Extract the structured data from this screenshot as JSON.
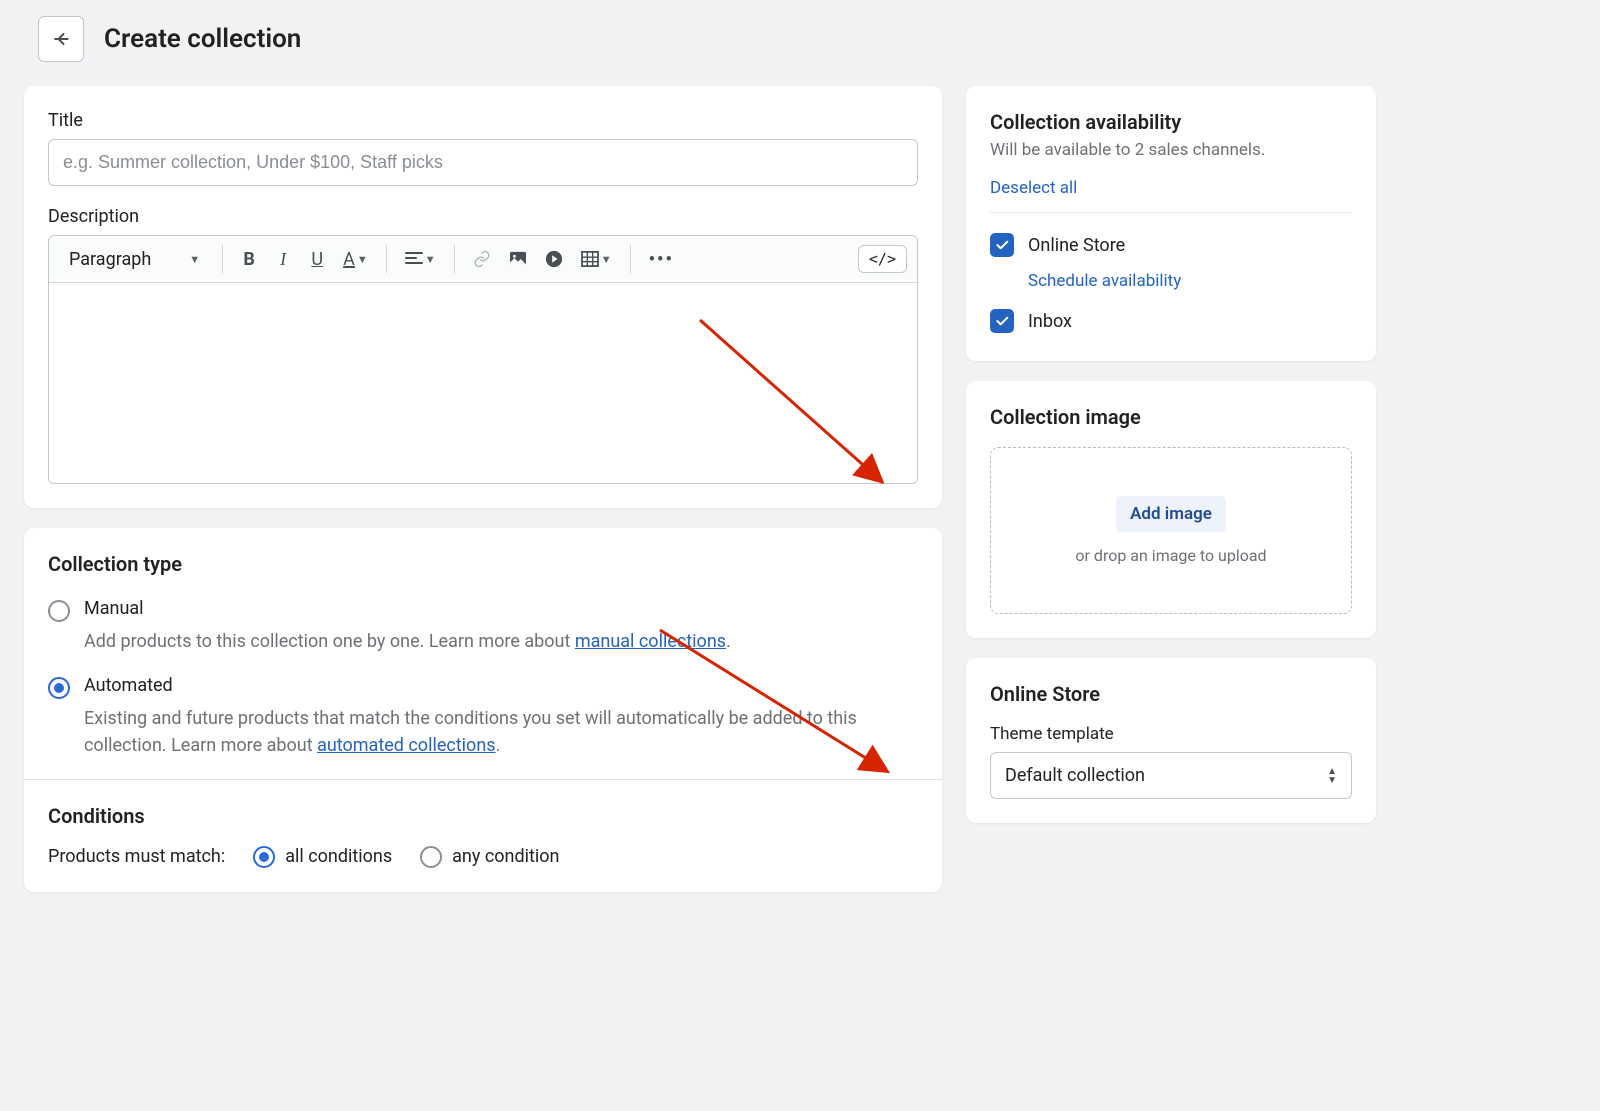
{
  "header": {
    "title": "Create collection"
  },
  "main": {
    "title_label": "Title",
    "title_placeholder": "e.g. Summer collection, Under $100, Staff picks",
    "description_label": "Description",
    "toolbar": {
      "format_select": "Paragraph",
      "code_label": "</>"
    },
    "collection_type": {
      "heading": "Collection type",
      "manual": {
        "label": "Manual",
        "desc_prefix": "Add products to this collection one by one. Learn more about ",
        "link": "manual collections",
        "desc_suffix": "."
      },
      "automated": {
        "label": "Automated",
        "desc_prefix": "Existing and future products that match the conditions you set will automatically be added to this collection. Learn more about ",
        "link": "automated collections",
        "desc_suffix": "."
      }
    },
    "conditions": {
      "heading": "Conditions",
      "match_label": "Products must match:",
      "all": "all conditions",
      "any": "any condition"
    }
  },
  "sidebar": {
    "availability": {
      "heading": "Collection availability",
      "sub": "Will be available to 2 sales channels.",
      "deselect": "Deselect all",
      "channels": {
        "online_store": "Online Store",
        "schedule": "Schedule availability",
        "inbox": "Inbox"
      }
    },
    "image": {
      "heading": "Collection image",
      "add_btn": "Add image",
      "hint": "or drop an image to upload"
    },
    "online_store": {
      "heading": "Online Store",
      "template_label": "Theme template",
      "selected": "Default collection"
    }
  }
}
